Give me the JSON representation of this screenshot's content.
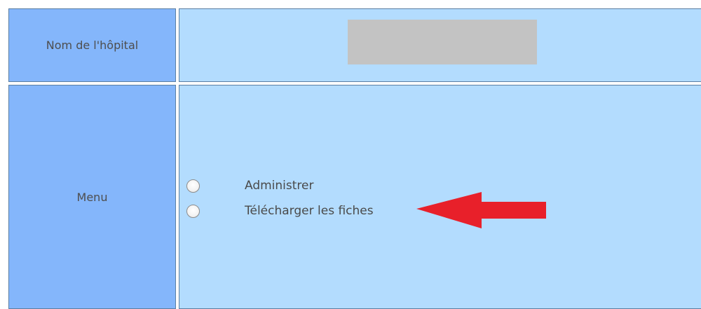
{
  "form": {
    "hospital_label": "Nom de l'hôpital",
    "hospital_value": "",
    "menu_label": "Menu",
    "options": [
      {
        "label": "Administrer",
        "selected": false
      },
      {
        "label": "Télécharger les fiches",
        "selected": false
      }
    ]
  },
  "annotation": {
    "arrow_color": "#e8202a",
    "arrow_target": "Télécharger les fiches"
  },
  "colors": {
    "label_cell": "#84b6fb",
    "content_cell": "#b3dcfe",
    "redacted_box": "#c3c3c3"
  }
}
